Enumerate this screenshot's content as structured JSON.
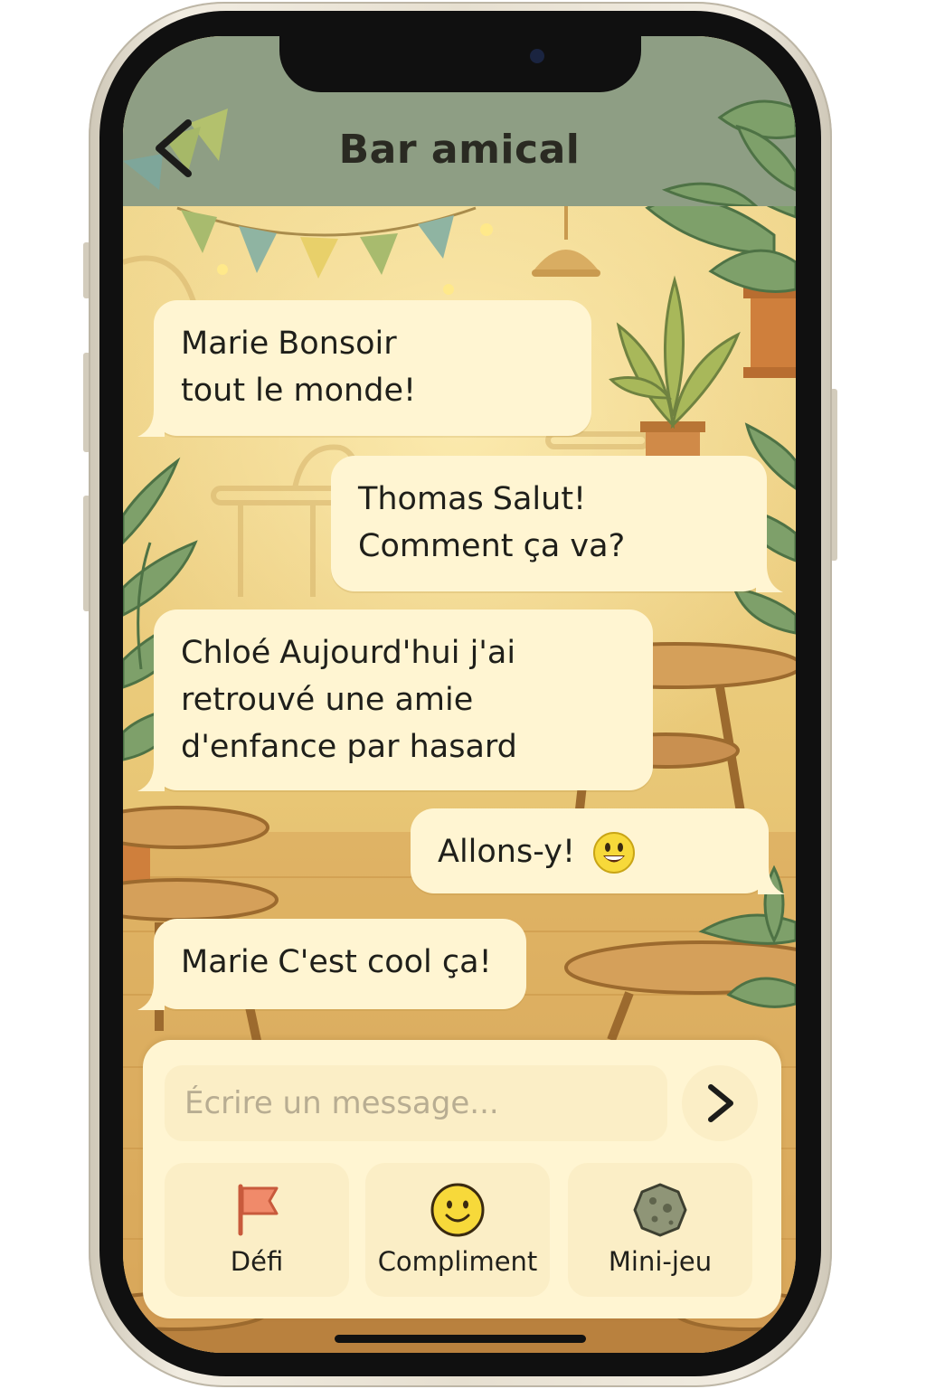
{
  "header": {
    "title": "Bar amical",
    "back_icon": "chevron-left-icon"
  },
  "messages": [
    {
      "sender": "Marie",
      "text_line1": "Bonsoir",
      "text_line2": "tout le monde!",
      "side": "left"
    },
    {
      "sender": "Thomas",
      "text_line1": "Salut!",
      "text_line2": "Comment ça va?",
      "side": "right"
    },
    {
      "sender": "Chloé",
      "text_line1": "Aujourd'hui j'ai",
      "text_line2": "retrouvé une amie",
      "text_line3": "d'enfance par hasard",
      "side": "left"
    },
    {
      "sender": "",
      "text_line1": "Allons-y!",
      "emoji": "grinning-face-icon",
      "side": "right"
    },
    {
      "sender": "Marie",
      "text_line1": "C'est cool ça!",
      "side": "left"
    }
  ],
  "composer": {
    "placeholder": "Écrire un message...",
    "send_icon": "chevron-right-icon"
  },
  "actions": [
    {
      "label": "Défi",
      "icon": "flag-icon"
    },
    {
      "label": "Compliment",
      "icon": "smiley-icon"
    },
    {
      "label": "Mini-jeu",
      "icon": "stone-icon"
    }
  ],
  "colors": {
    "header_bg": "#8e9e84",
    "scene_bg": "#e7c982",
    "bubble_bg": "#fff5d2",
    "flag": "#f08a6a",
    "smiley": "#f7d93a"
  }
}
